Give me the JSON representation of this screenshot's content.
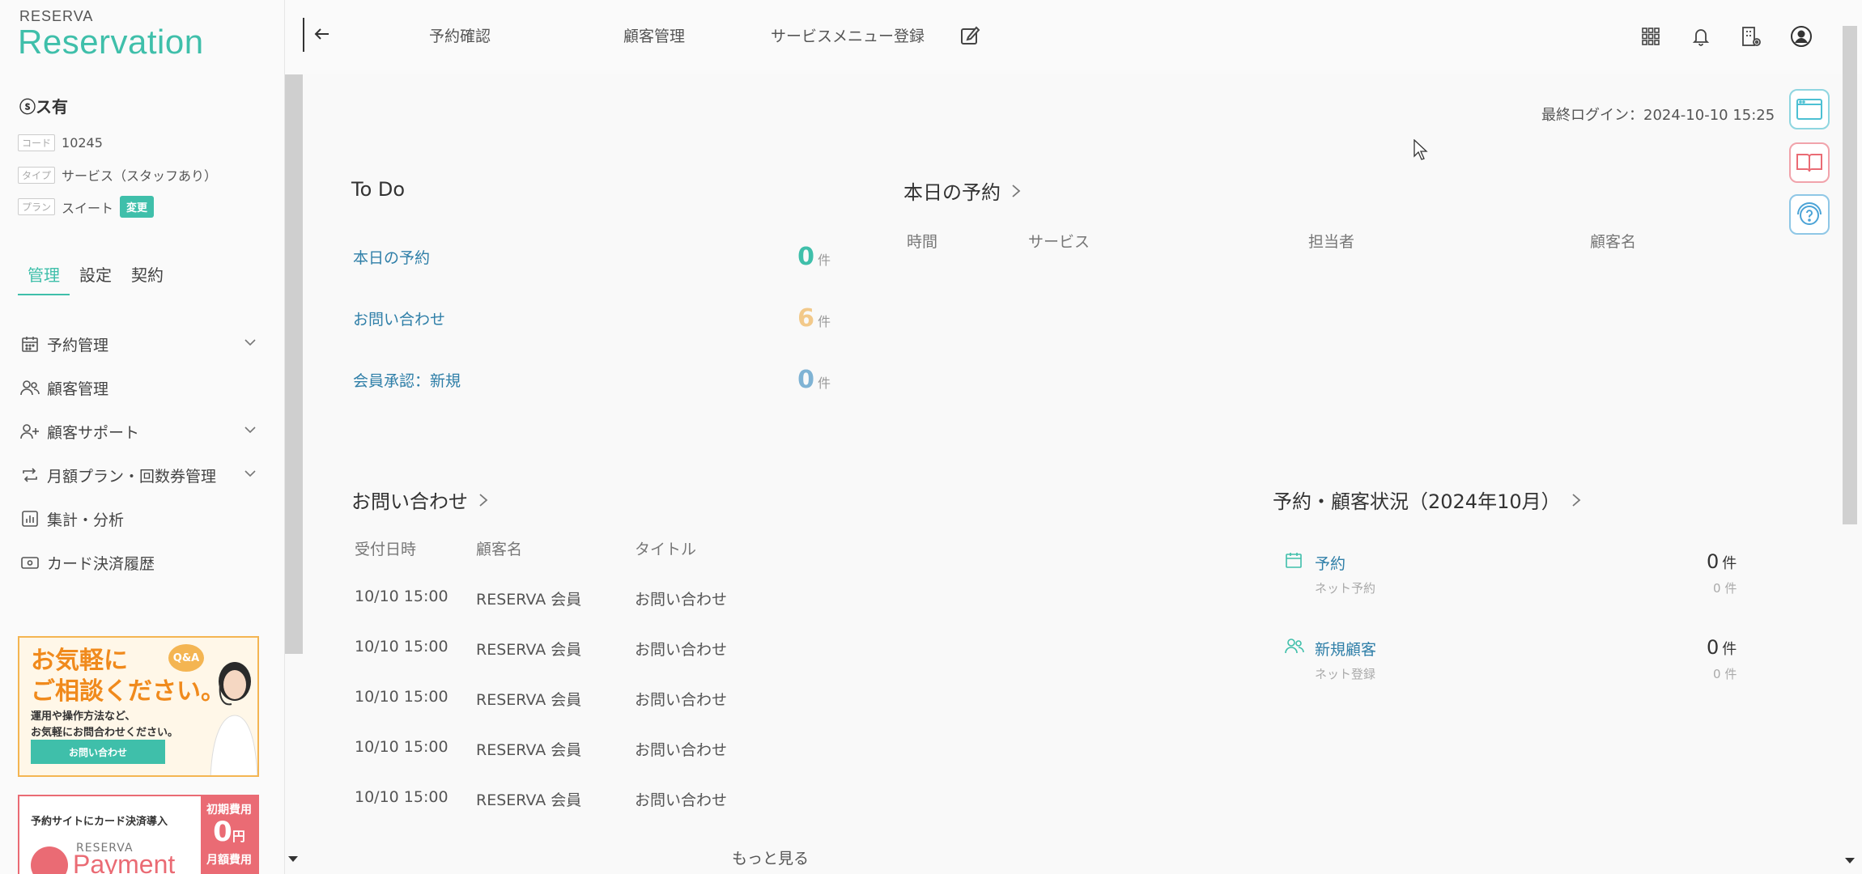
{
  "brand": {
    "small": "RESERVA",
    "big": "Reservation"
  },
  "store": {
    "name": "ⓢス有",
    "code_tag": "コード",
    "code": "10245",
    "type_tag": "タイプ",
    "type": "サービス（スタッフあり）",
    "plan_tag": "プラン",
    "plan": "スイート",
    "change_label": "変更"
  },
  "sidebar_tabs": [
    "管理",
    "設定",
    "契約"
  ],
  "sidebar_menu": [
    {
      "label": "予約管理",
      "icon": "calendar-icon",
      "expandable": true
    },
    {
      "label": "顧客管理",
      "icon": "users-icon",
      "expandable": false
    },
    {
      "label": "顧客サポート",
      "icon": "user-plus-icon",
      "expandable": true
    },
    {
      "label": "月額プラン・回数券管理",
      "icon": "repeat-icon",
      "expandable": true
    },
    {
      "label": "集計・分析",
      "icon": "bar-chart-icon",
      "expandable": false
    },
    {
      "label": "カード決済履歴",
      "icon": "card-icon",
      "expandable": false
    }
  ],
  "banner_contact": {
    "title_line1": "お気軽に",
    "title_line2": "ご相談ください。",
    "badge": "Q&A",
    "sub_line1": "運用や操作方法など、",
    "sub_line2": "お気軽にお問合わせください。",
    "button": "お問い合わせ"
  },
  "banner_payment": {
    "title": "予約サイトにカード決済導入",
    "logo_small": "RESERVA",
    "logo": "Payment",
    "fee1_label": "初期費用",
    "fee1_value": "0",
    "fee_unit": "円",
    "fee2_label": "月額費用"
  },
  "topbar": {
    "links": [
      "予約確認",
      "顧客管理",
      "サービスメニュー登録"
    ],
    "icons": [
      "apps-grid-icon",
      "bell-icon",
      "building-settings-icon",
      "account-icon"
    ]
  },
  "last_login": "最終ログイン：2024-10-10 15:25",
  "todo": {
    "title": "To Do",
    "unit": "件",
    "rows": [
      {
        "label": "本日の予約",
        "count": "0",
        "color": "#3fbfaa"
      },
      {
        "label": "お問い合わせ",
        "count": "6",
        "color": "#f2c98a"
      },
      {
        "label": "会員承認：新規",
        "count": "0",
        "color": "#7fb3d4"
      }
    ]
  },
  "today_reservations": {
    "title": "本日の予約",
    "columns": [
      "時間",
      "サービス",
      "担当者",
      "顧客名"
    ]
  },
  "inquiries": {
    "title": "お問い合わせ",
    "columns": [
      "受付日時",
      "顧客名",
      "タイトル"
    ],
    "rows": [
      [
        "10/10 15:00",
        "RESERVA 会員",
        "お問い合わせ"
      ],
      [
        "10/10 15:00",
        "RESERVA 会員",
        "お問い合わせ"
      ],
      [
        "10/10 15:00",
        "RESERVA 会員",
        "お問い合わせ"
      ],
      [
        "10/10 15:00",
        "RESERVA 会員",
        "お問い合わせ"
      ],
      [
        "10/10 15:00",
        "RESERVA 会員",
        "お問い合わせ"
      ]
    ],
    "more": "もっと見る"
  },
  "status": {
    "title": "予約・顧客状況（2024年10月）",
    "items": [
      {
        "label": "予約",
        "sub": "ネット予約",
        "count": "0",
        "sub_count": "0",
        "unit": "件"
      },
      {
        "label": "新規顧客",
        "sub": "ネット登録",
        "count": "0",
        "sub_count": "0",
        "unit": "件"
      }
    ]
  },
  "colors": {
    "accent": "#3fbfaa",
    "link": "#2f7fa8",
    "warning": "#f2c98a",
    "pink": "#ea6b74"
  }
}
